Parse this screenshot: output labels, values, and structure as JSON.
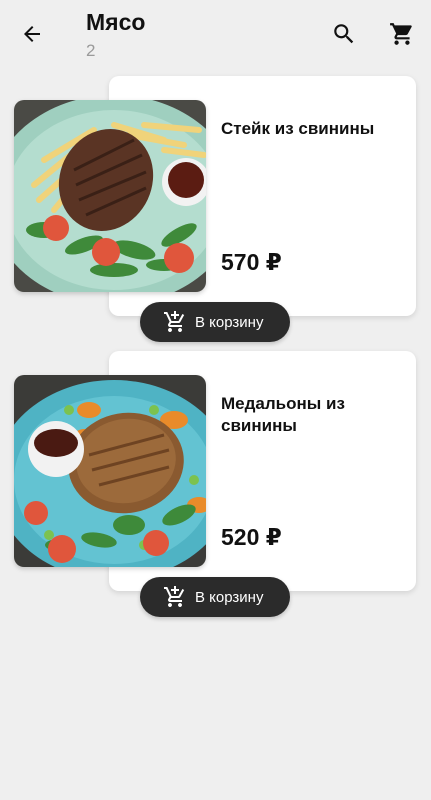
{
  "header": {
    "title": "Мясо",
    "subtitle": "2",
    "icons": {
      "back": "arrow-back-icon",
      "search": "search-icon",
      "cart": "cart-icon"
    }
  },
  "products": [
    {
      "name": "Стейк из свинины",
      "price": "570 ₽",
      "button_label": "В корзину",
      "image": "pork-steak-with-fries-photo"
    },
    {
      "name": "Медальоны из свинины",
      "price": "520 ₽",
      "button_label": "В корзину",
      "image": "pork-medallions-photo"
    }
  ],
  "colors": {
    "background": "#efefef",
    "card": "#ffffff",
    "button": "#2b2b2b",
    "text": "#111111",
    "muted": "#9a9a9a"
  }
}
